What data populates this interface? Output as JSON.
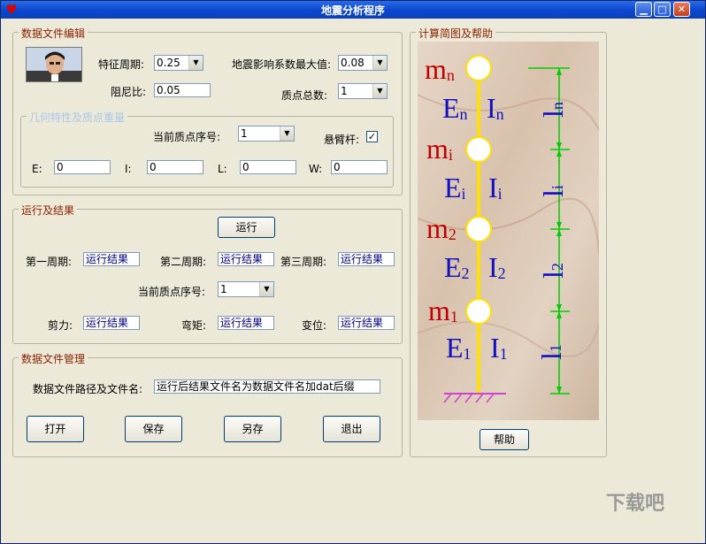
{
  "window": {
    "title": "地震分析程序",
    "app_icon": "heart-icon"
  },
  "titlebar_buttons": {
    "minimize": "▁",
    "maximize": "□",
    "close": "✕"
  },
  "group_edit": {
    "title": "数据文件编辑",
    "char_period_label": "特征周期:",
    "char_period_value": "0.25",
    "seismic_label": "地震影响系数最大值:",
    "seismic_value": "0.08",
    "damping_label": "阻尼比:",
    "damping_value": "0.05",
    "mass_count_label": "质点总数:",
    "mass_count_value": "1"
  },
  "group_geometry": {
    "title": "几何特性及质点重量",
    "current_mass_label": "当前质点序号:",
    "current_mass_value": "1",
    "cantilever_label": "悬臂杆:",
    "cantilever_checked": "✓",
    "e_label": "E:",
    "e_value": "0",
    "i_label": "I:",
    "i_value": "0",
    "l_label": "L:",
    "l_value": "0",
    "w_label": "W:",
    "w_value": "0"
  },
  "group_run": {
    "title": "运行及结果",
    "run_button": "运行",
    "period1_label": "第一周期:",
    "period1_value": "运行结果",
    "period2_label": "第二周期:",
    "period2_value": "运行结果",
    "period3_label": "第三周期:",
    "period3_value": "运行结果",
    "current_mass_label": "当前质点序号:",
    "current_mass_value": "1",
    "shear_label": "剪力:",
    "shear_value": "运行结果",
    "moment_label": "弯矩:",
    "moment_value": "运行结果",
    "displacement_label": "变位:",
    "displacement_value": "运行结果"
  },
  "group_file": {
    "title": "数据文件管理",
    "path_label": "数据文件路径及文件名:",
    "path_value": "运行后结果文件名为数据文件名加dat后缀",
    "open_button": "打开",
    "save_button": "保存",
    "saveas_button": "另存",
    "exit_button": "退出"
  },
  "group_diagram": {
    "title": "计算简图及帮助",
    "help_button": "帮助",
    "masses": [
      {
        "m": "m",
        "sub": "n",
        "E": "E",
        "Es": "n",
        "I": "I",
        "Is": "n",
        "l": "l",
        "ls": "n"
      },
      {
        "m": "m",
        "sub": "i",
        "E": "E",
        "Es": "i",
        "I": "I",
        "Is": "i",
        "l": "l",
        "ls": "i"
      },
      {
        "m": "m",
        "sub": "2",
        "E": "E",
        "Es": "2",
        "I": "I",
        "Is": "2",
        "l": "l",
        "ls": "2"
      },
      {
        "m": "m",
        "sub": "1",
        "E": "E",
        "Es": "1",
        "I": "I",
        "Is": "1",
        "l": "l",
        "ls": "1"
      }
    ]
  },
  "watermark": "下载吧"
}
